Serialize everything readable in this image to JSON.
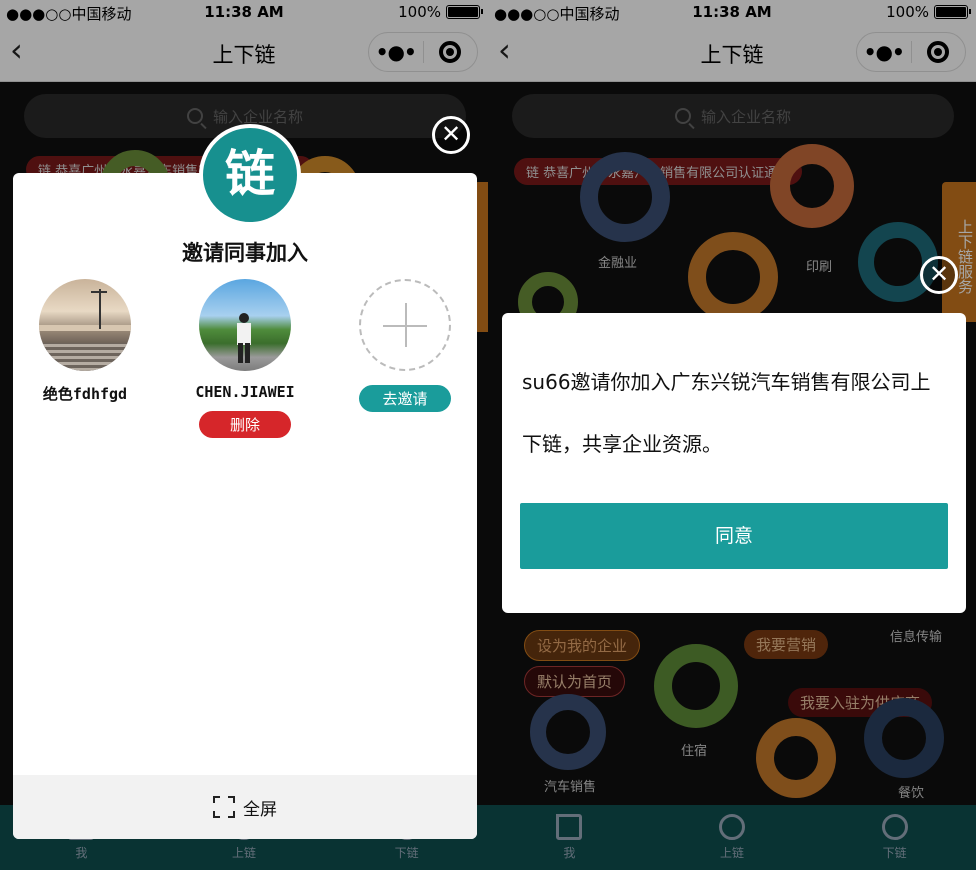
{
  "status_bar": {
    "carrier": "●●●○○中国移动",
    "time": "11:38 AM",
    "battery": "100%"
  },
  "nav": {
    "title": "上下链",
    "back_icon": "‹",
    "more_label": "•●•"
  },
  "search": {
    "placeholder": "输入企业名称"
  },
  "tabbar": {
    "items": [
      {
        "label": "我"
      },
      {
        "label": "上链"
      },
      {
        "label": "下链"
      }
    ]
  },
  "left_modal": {
    "logo_char": "链",
    "title": "邀请同事加入",
    "members": [
      {
        "name": "绝色fdhfgd"
      },
      {
        "name": "CHEN.JIAWEI",
        "delete_label": "删除"
      }
    ],
    "invite_label": "去邀请",
    "fullscreen_label": "全屏"
  },
  "left_background": {
    "banner_char": "链",
    "banner_text": "恭喜广州市永嘉汽车销售有限公司认证通过"
  },
  "right_background": {
    "banner_char": "链",
    "banner_text": "恭喜广州市永嘉汽车销售有限公司认证通过",
    "side_tab": "上下链服务",
    "industries": [
      "金融业",
      "印刷",
      "信息传输",
      "住宿",
      "汽车销售",
      "餐饮"
    ],
    "actions": [
      "设为我的企业",
      "默认为首页",
      "我要营销",
      "我要入驻为供应商"
    ]
  },
  "right_modal": {
    "message": "su66邀请你加入广东兴锐汽车销售有限公司上下链，共享企业资源。",
    "agree_label": "同意"
  },
  "colors": {
    "teal": "#1a9c9b",
    "red": "#d6262a",
    "orange": "#c8761e"
  }
}
